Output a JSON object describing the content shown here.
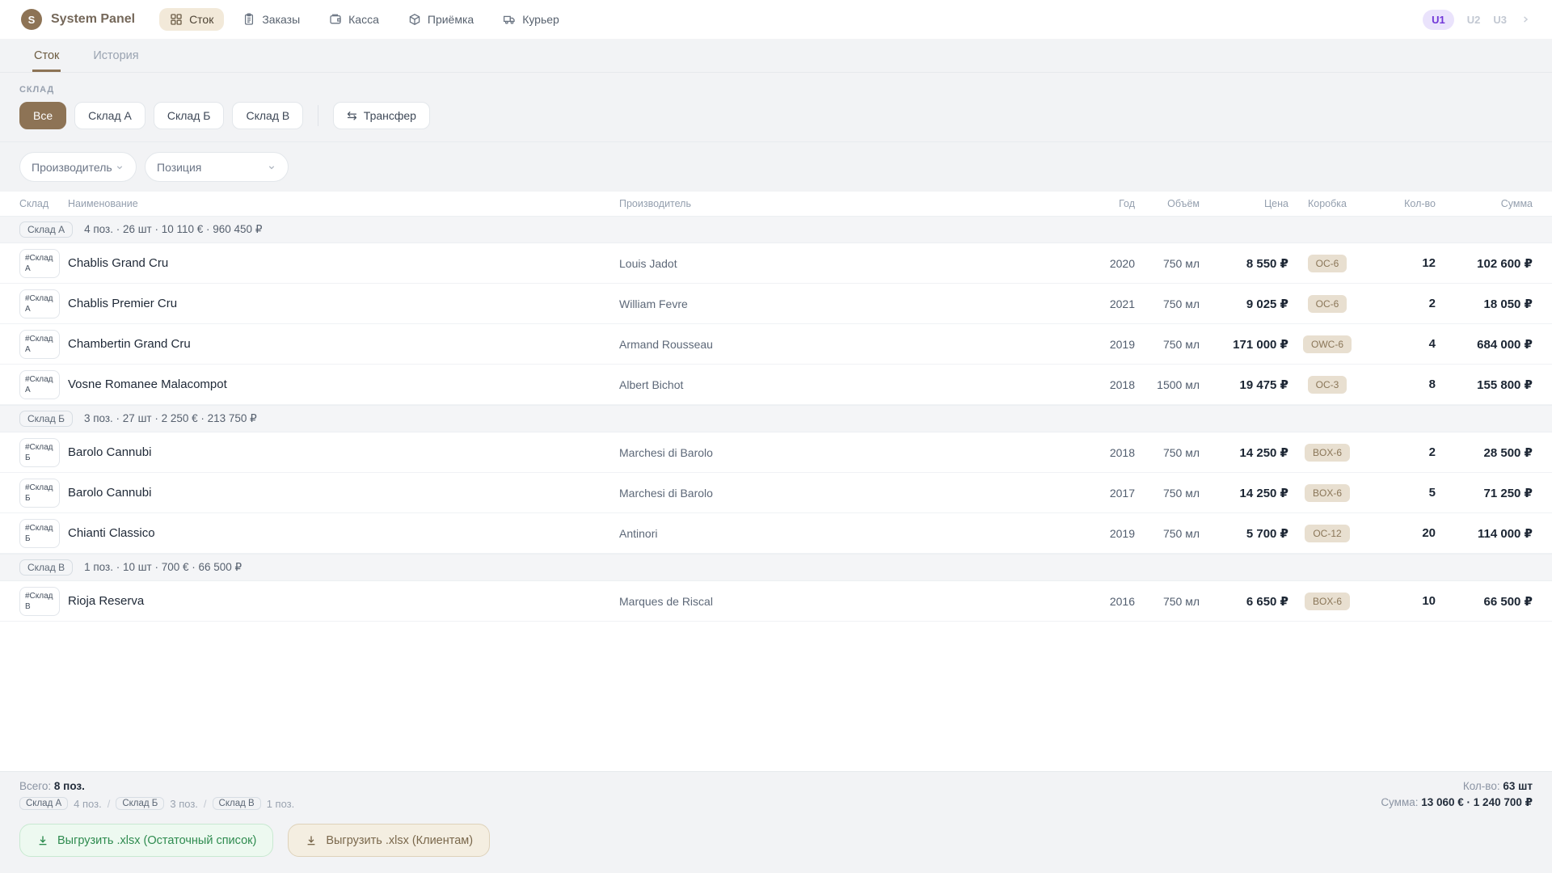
{
  "topbar": {
    "logo_letter": "S",
    "app_name": "System Panel",
    "nav": [
      {
        "label": "Сток",
        "active": true
      },
      {
        "label": "Заказы",
        "active": false
      },
      {
        "label": "Касса",
        "active": false
      },
      {
        "label": "Приёмка",
        "active": false
      },
      {
        "label": "Курьер",
        "active": false
      }
    ],
    "users": [
      "U1",
      "U2",
      "U3"
    ]
  },
  "tabs": [
    {
      "label": "Сток",
      "active": true
    },
    {
      "label": "История",
      "active": false
    }
  ],
  "filters": {
    "warehouse_label": "СКЛАД",
    "warehouse_options": [
      {
        "label": "Все",
        "active": true
      },
      {
        "label": "Склад А",
        "active": false
      },
      {
        "label": "Склад Б",
        "active": false
      },
      {
        "label": "Склад В",
        "active": false
      }
    ],
    "transfer_label": "Трансфер",
    "transfer_icon": "⇆",
    "producer_placeholder": "Производитель",
    "position_placeholder": "Позиция"
  },
  "table": {
    "columns": [
      "Склад",
      "Наименование",
      "Производитель",
      "Год",
      "Объём",
      "Цена",
      "Коробка",
      "Кол-во",
      "Сумма"
    ],
    "groups": [
      {
        "badge": "Склад А",
        "stats": "4 поз. · 26 шт · 10 110 € · 960 450 ₽",
        "rows": [
          {
            "wh_tag": "#Склад А",
            "name": "Chablis Grand Cru",
            "producer": "Louis Jadot",
            "year": "2020",
            "volume": "750 мл",
            "price": "8 550 ₽",
            "box": "OC-6",
            "qty": "12",
            "sum": "102 600 ₽"
          },
          {
            "wh_tag": "#Склад А",
            "name": "Chablis Premier Cru",
            "producer": "William Fevre",
            "year": "2021",
            "volume": "750 мл",
            "price": "9 025 ₽",
            "box": "OC-6",
            "qty": "2",
            "sum": "18 050 ₽"
          },
          {
            "wh_tag": "#Склад А",
            "name": "Chambertin Grand Cru",
            "producer": "Armand Rousseau",
            "year": "2019",
            "volume": "750 мл",
            "price": "171 000 ₽",
            "box": "OWC-6",
            "qty": "4",
            "sum": "684 000 ₽"
          },
          {
            "wh_tag": "#Склад А",
            "name": "Vosne Romanee Malacompot",
            "producer": "Albert Bichot",
            "year": "2018",
            "volume": "1500 мл",
            "price": "19 475 ₽",
            "box": "OC-3",
            "qty": "8",
            "sum": "155 800 ₽"
          }
        ]
      },
      {
        "badge": "Склад Б",
        "stats": "3 поз. · 27 шт · 2 250 € · 213 750 ₽",
        "rows": [
          {
            "wh_tag": "#Склад Б",
            "name": "Barolo Cannubi",
            "producer": "Marchesi di Barolo",
            "year": "2018",
            "volume": "750 мл",
            "price": "14 250 ₽",
            "box": "BOX-6",
            "qty": "2",
            "sum": "28 500 ₽"
          },
          {
            "wh_tag": "#Склад Б",
            "name": "Barolo Cannubi",
            "producer": "Marchesi di Barolo",
            "year": "2017",
            "volume": "750 мл",
            "price": "14 250 ₽",
            "box": "BOX-6",
            "qty": "5",
            "sum": "71 250 ₽"
          },
          {
            "wh_tag": "#Склад Б",
            "name": "Chianti Classico",
            "producer": "Antinori",
            "year": "2019",
            "volume": "750 мл",
            "price": "5 700 ₽",
            "box": "OC-12",
            "qty": "20",
            "sum": "114 000 ₽"
          }
        ]
      },
      {
        "badge": "Склад В",
        "stats": "1 поз. · 10 шт · 700 € · 66 500 ₽",
        "rows": [
          {
            "wh_tag": "#Склад В",
            "name": "Rioja Reserva",
            "producer": "Marques de Riscal",
            "year": "2016",
            "volume": "750 мл",
            "price": "6 650 ₽",
            "box": "BOX-6",
            "qty": "10",
            "sum": "66 500 ₽"
          }
        ]
      }
    ]
  },
  "footer": {
    "total_label": "Всего:",
    "total_value": "8 поз.",
    "breakdown": [
      {
        "badge": "Склад А",
        "count": "4 поз."
      },
      {
        "badge": "Склад Б",
        "count": "3 поз."
      },
      {
        "badge": "Склад В",
        "count": "1 поз."
      }
    ],
    "qty_label": "Кол-во:",
    "qty_value": "63 шт",
    "sum_label": "Сумма:",
    "sum_value": "13 060 € · 1 240 700 ₽"
  },
  "actions": [
    {
      "label": "Выгрузить .xlsx (Остаточный список)",
      "variant": "green"
    },
    {
      "label": "Выгрузить .xlsx (Клиентам)",
      "variant": "beige"
    }
  ],
  "colors": {
    "accent_brown": "#8d7355",
    "nav_active_bg": "#f2e9d9",
    "chip_bg": "#e8dfd0",
    "chip_text": "#8a7658",
    "user_active_bg": "#eae3fc",
    "user_active_text": "#7137d8",
    "export_green_text": "#2e8b4f",
    "export_beige_text": "#7a684c"
  }
}
